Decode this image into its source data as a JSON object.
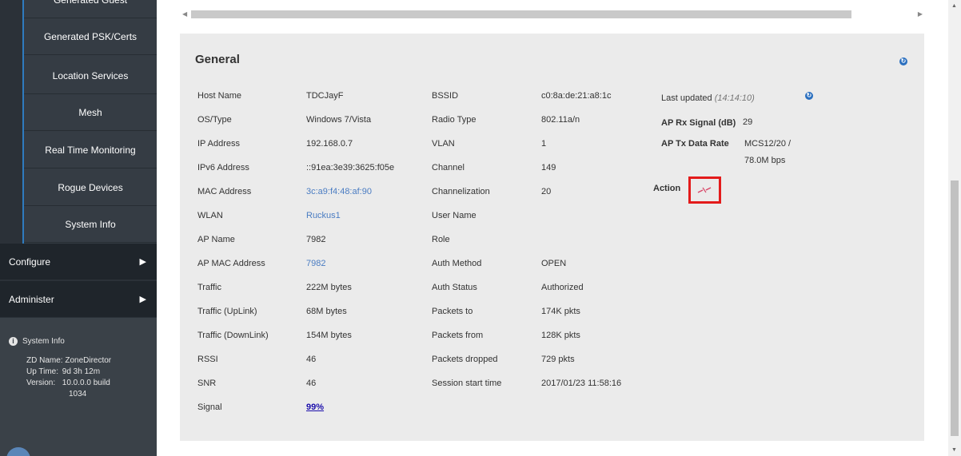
{
  "sidebar": {
    "sub_items": [
      {
        "label": "Generated Guest"
      },
      {
        "label": "Generated PSK/Certs"
      },
      {
        "label": "Location Services"
      },
      {
        "label": "Mesh"
      },
      {
        "label": "Real Time Monitoring"
      },
      {
        "label": "Rogue Devices"
      },
      {
        "label": "System Info"
      }
    ],
    "main_items": [
      {
        "label": "Configure"
      },
      {
        "label": "Administer"
      }
    ],
    "system_info": {
      "title": "System Info",
      "zd_name_label": "ZD Name:",
      "zd_name_value": "ZoneDirector",
      "uptime_label": "Up Time:",
      "uptime_value": "9d 3h 12m",
      "version_label": "Version:",
      "version_value": "10.0.0.0 build",
      "version_build": "1034"
    }
  },
  "panel": {
    "title": "General",
    "col1": [
      {
        "label": "Host Name",
        "value": "TDCJayF"
      },
      {
        "label": "OS/Type",
        "value": "Windows 7/Vista"
      },
      {
        "label": "IP Address",
        "value": "192.168.0.7"
      },
      {
        "label": "IPv6 Address",
        "value": "::91ea:3e39:3625:f05e"
      },
      {
        "label": "MAC Address",
        "value": "3c:a9:f4:48:af:90"
      },
      {
        "label": "WLAN",
        "value": "Ruckus1"
      },
      {
        "label": "AP Name",
        "value": "7982"
      },
      {
        "label": "AP MAC Address",
        "value": "7982"
      },
      {
        "label": "Traffic",
        "value": "222M bytes"
      },
      {
        "label": "Traffic (UpLink)",
        "value": "68M bytes"
      },
      {
        "label": "Traffic (DownLink)",
        "value": "154M bytes"
      },
      {
        "label": "RSSI",
        "value": "46"
      },
      {
        "label": "SNR",
        "value": "46"
      },
      {
        "label": "Signal",
        "value": "99%"
      }
    ],
    "col2": [
      {
        "label": "BSSID",
        "value": "c0:8a:de:21:a8:1c"
      },
      {
        "label": "Radio Type",
        "value": "802.11a/n"
      },
      {
        "label": "VLAN",
        "value": "1"
      },
      {
        "label": "Channel",
        "value": "149"
      },
      {
        "label": "Channelization",
        "value": "20"
      },
      {
        "label": "User Name",
        "value": ""
      },
      {
        "label": "Role",
        "value": ""
      },
      {
        "label": "Auth Method",
        "value": "OPEN"
      },
      {
        "label": "Auth Status",
        "value": "Authorized"
      },
      {
        "label": "Packets to",
        "value": "174K pkts"
      },
      {
        "label": "Packets from",
        "value": "128K pkts"
      },
      {
        "label": "Packets dropped",
        "value": "729 pkts"
      },
      {
        "label": "Session start time",
        "value": "2017/01/23  11:58:16"
      }
    ],
    "right": {
      "last_updated_label": "Last updated",
      "last_updated_time": "(14:14:10)",
      "rx_label": "AP Rx Signal (dB)",
      "rx_value": "29",
      "tx_label": "AP Tx Data Rate",
      "tx_value_1": "MCS12/20 /",
      "tx_value_2": "78.0M bps",
      "action_label": "Action"
    }
  },
  "colors": {
    "accent": "#2a6fbf",
    "highlight_box": "#e31b1b",
    "sidebar_bg": "#2b3138"
  }
}
